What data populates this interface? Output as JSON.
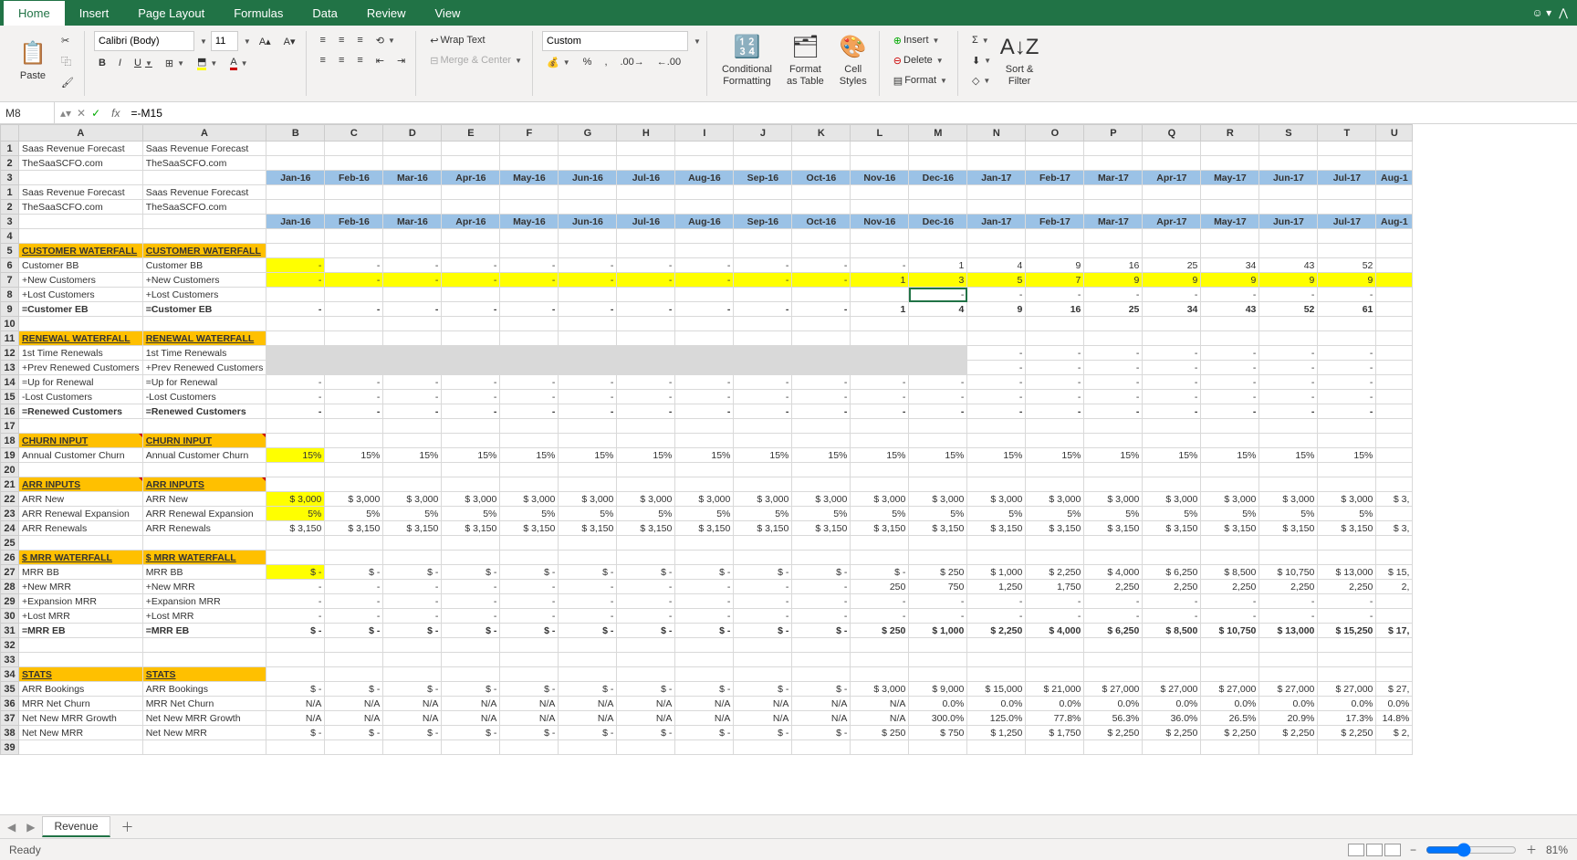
{
  "tabs": [
    "Home",
    "Insert",
    "Page Layout",
    "Formulas",
    "Data",
    "Review",
    "View"
  ],
  "active_tab": "Home",
  "clipboard": {
    "paste": "Paste"
  },
  "font": {
    "name": "Calibri (Body)",
    "size": "11"
  },
  "number_format": "Custom",
  "ribbon_labels": {
    "wrap": "Wrap Text",
    "merge": "Merge & Center",
    "cond": "Conditional",
    "cond2": "Formatting",
    "fmt_tbl": "Format",
    "fmt_tbl2": "as Table",
    "cell_styles": "Cell",
    "cell_styles2": "Styles",
    "insert": "Insert",
    "delete": "Delete",
    "format": "Format",
    "sort": "Sort &",
    "sort2": "Filter"
  },
  "name_box": "M8",
  "formula": "=-M15",
  "months": [
    "Jan-16",
    "Feb-16",
    "Mar-16",
    "Apr-16",
    "May-16",
    "Jun-16",
    "Jul-16",
    "Aug-16",
    "Sep-16",
    "Oct-16",
    "Nov-16",
    "Dec-16",
    "Jan-17",
    "Feb-17",
    "Mar-17",
    "Apr-17",
    "May-17",
    "Jun-17",
    "Jul-17",
    "Aug-1"
  ],
  "col_letters": [
    "A",
    "A",
    "B",
    "C",
    "D",
    "E",
    "F",
    "G",
    "H",
    "I",
    "J",
    "K",
    "L",
    "M",
    "N",
    "O",
    "P",
    "Q",
    "R",
    "S",
    "T",
    "U"
  ],
  "labels": {
    "title": "Saas Revenue Forecast",
    "site": "TheSaaSCFO.com",
    "cw": "CUSTOMER WATERFALL",
    "cbb": "Customer BB",
    "newc": "+New Customers",
    "lostc": "+Lost Customers",
    "ceb": "=Customer EB",
    "rw": "RENEWAL WATERFALL",
    "r1": "1st Time Renewals",
    "r2": "+Prev Renewed Customers",
    "r3": "=Up for Renewal",
    "r4": "-Lost Customers",
    "r5": "=Renewed Customers",
    "ci": "CHURN INPUT",
    "cc": "Annual Customer Churn",
    "ai": "ARR INPUTS",
    "an": "ARR New",
    "are": "ARR Renewal Expansion",
    "ar": "ARR Renewals",
    "mw": "$ MRR WATERFALL",
    "mbb": "MRR BB",
    "nmrr": "+New MRR",
    "emrr": "+Expansion MRR",
    "lmrr": "+Lost MRR",
    "meb": "=MRR EB",
    "st": "STATS",
    "ab": "ARR Bookings",
    "mnc": "MRR Net Churn",
    "nnmg": "Net New MRR Growth",
    "nnm": "Net New MRR"
  },
  "data": {
    "cbb": [
      "-",
      "-",
      "-",
      "-",
      "-",
      "-",
      "-",
      "-",
      "-",
      "-",
      "-",
      "1",
      "4",
      "9",
      "16",
      "25",
      "34",
      "43",
      "52",
      ""
    ],
    "newc": [
      "-",
      "-",
      "-",
      "-",
      "-",
      "-",
      "-",
      "-",
      "-",
      "-",
      "1",
      "3",
      "5",
      "7",
      "9",
      "9",
      "9",
      "9",
      "9",
      ""
    ],
    "lostc": [
      "",
      "",
      "",
      "",
      "",
      "",
      "",
      "",
      "",
      "",
      "",
      "-",
      "-",
      "-",
      "-",
      "-",
      "-",
      "-",
      "-",
      ""
    ],
    "ceb": [
      "-",
      "-",
      "-",
      "-",
      "-",
      "-",
      "-",
      "-",
      "-",
      "-",
      "1",
      "4",
      "9",
      "16",
      "25",
      "34",
      "43",
      "52",
      "61",
      ""
    ],
    "r1": [
      "",
      "",
      "",
      "",
      "",
      "",
      "",
      "",
      "",
      "",
      "",
      "",
      "-",
      "-",
      "-",
      "-",
      "-",
      "-",
      "-",
      ""
    ],
    "r2": [
      "",
      "",
      "",
      "",
      "",
      "",
      "",
      "",
      "",
      "",
      "",
      "",
      "-",
      "-",
      "-",
      "-",
      "-",
      "-",
      "-",
      ""
    ],
    "r3": [
      "-",
      "-",
      "-",
      "-",
      "-",
      "-",
      "-",
      "-",
      "-",
      "-",
      "-",
      "-",
      "-",
      "-",
      "-",
      "-",
      "-",
      "-",
      "-",
      ""
    ],
    "r4": [
      "-",
      "-",
      "-",
      "-",
      "-",
      "-",
      "-",
      "-",
      "-",
      "-",
      "-",
      "-",
      "-",
      "-",
      "-",
      "-",
      "-",
      "-",
      "-",
      ""
    ],
    "r5": [
      "-",
      "-",
      "-",
      "-",
      "-",
      "-",
      "-",
      "-",
      "-",
      "-",
      "-",
      "-",
      "-",
      "-",
      "-",
      "-",
      "-",
      "-",
      "-",
      ""
    ],
    "churn": [
      "15%",
      "15%",
      "15%",
      "15%",
      "15%",
      "15%",
      "15%",
      "15%",
      "15%",
      "15%",
      "15%",
      "15%",
      "15%",
      "15%",
      "15%",
      "15%",
      "15%",
      "15%",
      "15%",
      ""
    ],
    "arr_new": [
      "$   3,000",
      "$   3,000",
      "$   3,000",
      "$   3,000",
      "$   3,000",
      "$   3,000",
      "$   3,000",
      "$   3,000",
      "$   3,000",
      "$   3,000",
      "$   3,000",
      "$   3,000",
      "$   3,000",
      "$   3,000",
      "$   3,000",
      "$   3,000",
      "$   3,000",
      "$   3,000",
      "$   3,000",
      "$   3,"
    ],
    "arr_re": [
      "5%",
      "5%",
      "5%",
      "5%",
      "5%",
      "5%",
      "5%",
      "5%",
      "5%",
      "5%",
      "5%",
      "5%",
      "5%",
      "5%",
      "5%",
      "5%",
      "5%",
      "5%",
      "5%",
      ""
    ],
    "arr_r": [
      "$   3,150",
      "$   3,150",
      "$   3,150",
      "$   3,150",
      "$   3,150",
      "$   3,150",
      "$   3,150",
      "$   3,150",
      "$   3,150",
      "$   3,150",
      "$   3,150",
      "$   3,150",
      "$   3,150",
      "$   3,150",
      "$   3,150",
      "$   3,150",
      "$   3,150",
      "$   3,150",
      "$   3,150",
      "$   3,"
    ],
    "mbb": [
      "$       -",
      "$       -",
      "$       -",
      "$       -",
      "$       -",
      "$       -",
      "$       -",
      "$       -",
      "$       -",
      "$       -",
      "$       -",
      "$     250",
      "$   1,000",
      "$   2,250",
      "$   4,000",
      "$   6,250",
      "$   8,500",
      "$  10,750",
      "$  13,000",
      "$  15,"
    ],
    "nmrr": [
      "-",
      "-",
      "-",
      "-",
      "-",
      "-",
      "-",
      "-",
      "-",
      "-",
      "250",
      "750",
      "1,250",
      "1,750",
      "2,250",
      "2,250",
      "2,250",
      "2,250",
      "2,250",
      "2,"
    ],
    "emrr": [
      "-",
      "-",
      "-",
      "-",
      "-",
      "-",
      "-",
      "-",
      "-",
      "-",
      "-",
      "-",
      "-",
      "-",
      "-",
      "-",
      "-",
      "-",
      "-",
      ""
    ],
    "lmrr": [
      "-",
      "-",
      "-",
      "-",
      "-",
      "-",
      "-",
      "-",
      "-",
      "-",
      "-",
      "-",
      "-",
      "-",
      "-",
      "-",
      "-",
      "-",
      "-",
      ""
    ],
    "meb": [
      "$       -",
      "$       -",
      "$       -",
      "$       -",
      "$       -",
      "$       -",
      "$       -",
      "$       -",
      "$       -",
      "$       -",
      "$     250",
      "$   1,000",
      "$   2,250",
      "$   4,000",
      "$   6,250",
      "$   8,500",
      "$  10,750",
      "$  13,000",
      "$  15,250",
      "$  17,"
    ],
    "ab": [
      "$       -",
      "$       -",
      "$       -",
      "$       -",
      "$       -",
      "$       -",
      "$       -",
      "$       -",
      "$       -",
      "$       -",
      "$   3,000",
      "$   9,000",
      "$  15,000",
      "$  21,000",
      "$  27,000",
      "$  27,000",
      "$  27,000",
      "$  27,000",
      "$  27,000",
      "$  27,"
    ],
    "mnc": [
      "N/A",
      "N/A",
      "N/A",
      "N/A",
      "N/A",
      "N/A",
      "N/A",
      "N/A",
      "N/A",
      "N/A",
      "N/A",
      "0.0%",
      "0.0%",
      "0.0%",
      "0.0%",
      "0.0%",
      "0.0%",
      "0.0%",
      "0.0%",
      "0.0%"
    ],
    "nnmg": [
      "N/A",
      "N/A",
      "N/A",
      "N/A",
      "N/A",
      "N/A",
      "N/A",
      "N/A",
      "N/A",
      "N/A",
      "N/A",
      "300.0%",
      "125.0%",
      "77.8%",
      "56.3%",
      "36.0%",
      "26.5%",
      "20.9%",
      "17.3%",
      "14.8%"
    ],
    "nnm": [
      "$       -",
      "$       -",
      "$       -",
      "$       -",
      "$       -",
      "$       -",
      "$       -",
      "$       -",
      "$       -",
      "$       -",
      "$     250",
      "$     750",
      "$   1,250",
      "$   1,750",
      "$   2,250",
      "$   2,250",
      "$   2,250",
      "$   2,250",
      "$   2,250",
      "$   2,"
    ]
  },
  "sheet_tab": "Revenue",
  "status": "Ready",
  "zoom": "81%"
}
